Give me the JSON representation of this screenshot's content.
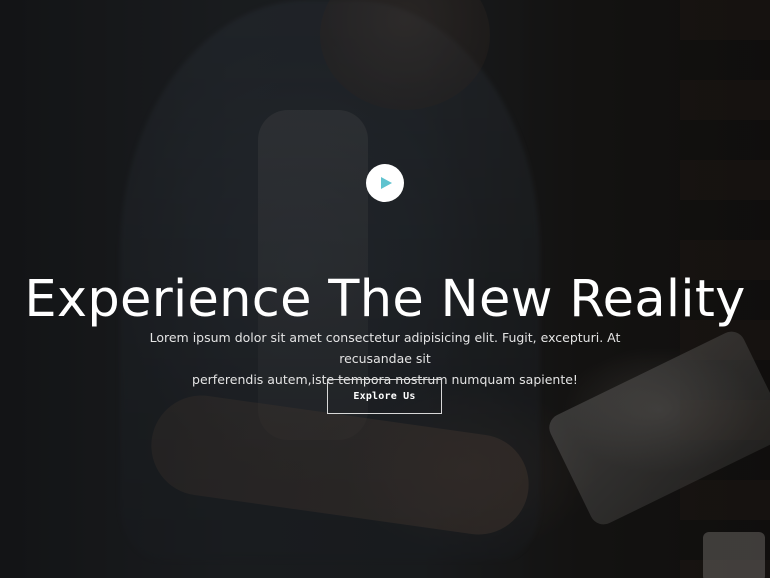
{
  "hero": {
    "play_icon": "play-icon",
    "play_color": "#5fc3cf",
    "title": "Experience The New Reality",
    "description_line1": "Lorem ipsum dolor sit amet consectetur adipisicing elit. Fugit, excepturi. At recusandae sit",
    "description_line2": "perferendis autem,iste tempora nostrum numquam sapiente!",
    "cta_label": "Explore Us"
  }
}
